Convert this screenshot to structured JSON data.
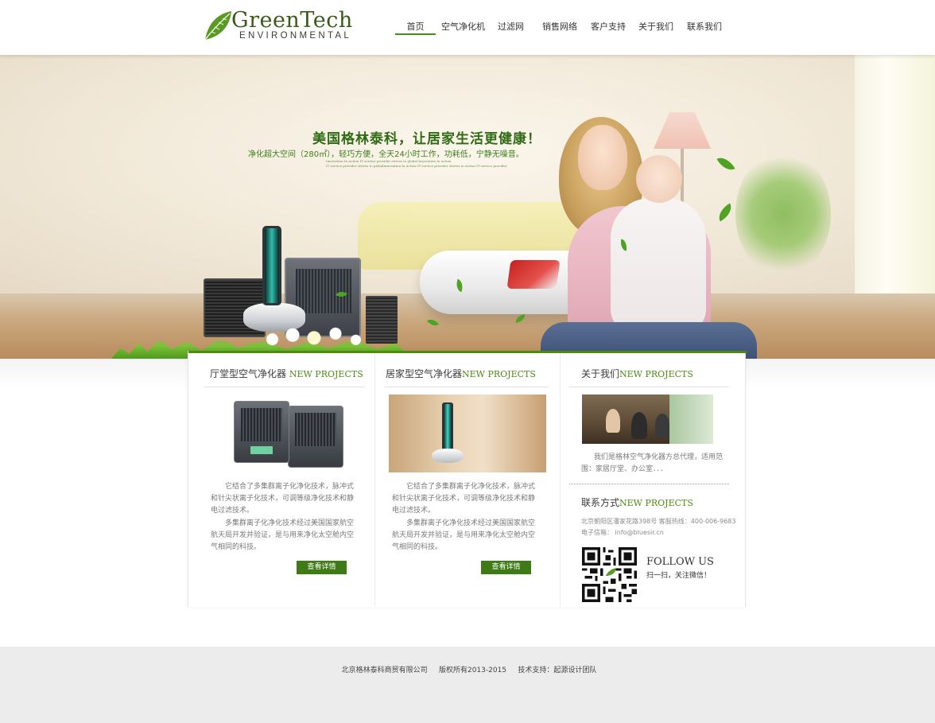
{
  "brand": {
    "name": "GreenTech",
    "tagline": "ENVIRONMENTAL",
    "accent_color": "#4c8a16"
  },
  "nav": {
    "items": [
      {
        "label": "首页",
        "active": true
      },
      {
        "label": "空气净化机",
        "active": false
      },
      {
        "label": "过滤网",
        "active": false
      },
      {
        "label": "销售网络",
        "active": false
      },
      {
        "label": "客户支持",
        "active": false
      },
      {
        "label": "关于我们",
        "active": false
      },
      {
        "label": "联系我们",
        "active": false
      }
    ]
  },
  "banner": {
    "title": "美国格林泰科，让居家生活更健康！",
    "subtitle": "净化超大空间（280㎡），轻巧方便，全天24小时工作，功耗低，宁静无噪音。",
    "en_line1": "Innovation In Action IT service provider strives to global Innovation In Action",
    "en_line2": "IT service provider strives to globalInnovation In Action IT service provider strives to Action IT service provider"
  },
  "sections": {
    "hall": {
      "title_cn": "厅堂型空气净化器",
      "title_en": "NEW PROJECTS",
      "para1": "它结合了多集群离子化净化技术，脉冲式和针尖状离子化技术，可调等级净化技术和静电过滤技术。",
      "para2": "多集群离子化净化技术经过美国国家航空航天局开发并验证，是与用来净化太空舱内空气相同的科技。",
      "button": "查看详情"
    },
    "home": {
      "title_cn": "居家型空气净化器",
      "title_en": "NEW PROJECTS",
      "para1": "它结合了多集群离子化净化技术，脉冲式和针尖状离子化技术，可调等级净化技术和静电过滤技术。",
      "para2": "多集群离子化净化技术经过美国国家航空航天局开发并验证，是与用来净化太空舱内空气相同的科技。",
      "button": "查看详情"
    },
    "about": {
      "title_cn": "关于我们",
      "title_en": "NEW PROJECTS",
      "text": "我们是格林空气净化器方总代理，适用范围：家居厅堂、办公室．．．"
    },
    "contact": {
      "title_cn": "联系方式",
      "title_en": "NEW PROJECTS",
      "address": "北京朝阳区潘家花路398号  客服热线：400-006-9683",
      "email": "电子信箱： info@bluesir.cn",
      "follow": "FOLLOW US",
      "follow_sub": "扫一扫，关注微信！"
    }
  },
  "footer": {
    "company": "北京格林泰科商贸有限公司",
    "copyright": "版权所有2013-2015",
    "support": "技术支持：起源设计团队"
  }
}
